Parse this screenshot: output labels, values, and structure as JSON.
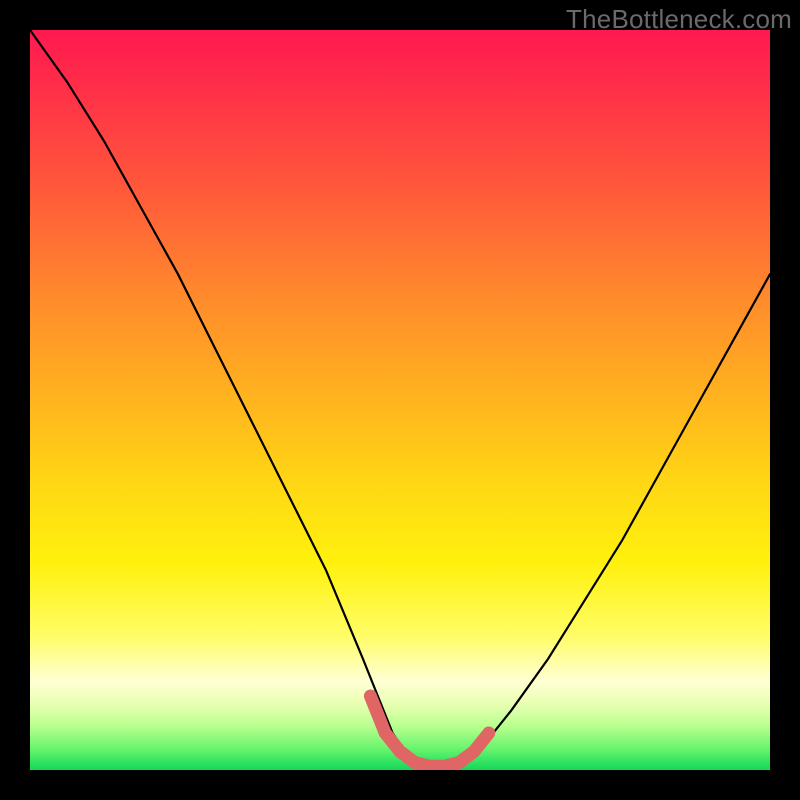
{
  "watermark": "TheBottleneck.com",
  "chart_data": {
    "type": "line",
    "title": "",
    "xlabel": "",
    "ylabel": "",
    "xlim": [
      0,
      100
    ],
    "ylim": [
      0,
      100
    ],
    "series": [
      {
        "name": "curve",
        "x": [
          0,
          5,
          10,
          15,
          20,
          25,
          30,
          35,
          40,
          45,
          47,
          49,
          51,
          53,
          55,
          57,
          59,
          61,
          65,
          70,
          75,
          80,
          85,
          90,
          95,
          100
        ],
        "y": [
          100,
          93,
          85,
          76,
          67,
          57,
          47,
          37,
          27,
          15,
          10,
          5,
          2,
          0,
          0,
          0,
          1,
          3,
          8,
          15,
          23,
          31,
          40,
          49,
          58,
          67
        ]
      },
      {
        "name": "highlight",
        "x": [
          46,
          48,
          50,
          52,
          54,
          56,
          58,
          60,
          62
        ],
        "y": [
          10,
          5,
          2.5,
          1,
          0.5,
          0.5,
          1,
          2.5,
          5
        ]
      }
    ],
    "gradient_stops": [
      {
        "pos": 0,
        "color": "#ff1950"
      },
      {
        "pos": 22,
        "color": "#ff5a3a"
      },
      {
        "pos": 50,
        "color": "#ffb41e"
      },
      {
        "pos": 72,
        "color": "#fff10d"
      },
      {
        "pos": 88,
        "color": "#ffffd4"
      },
      {
        "pos": 100,
        "color": "#12d95a"
      }
    ],
    "highlight_color": "#e06666"
  }
}
